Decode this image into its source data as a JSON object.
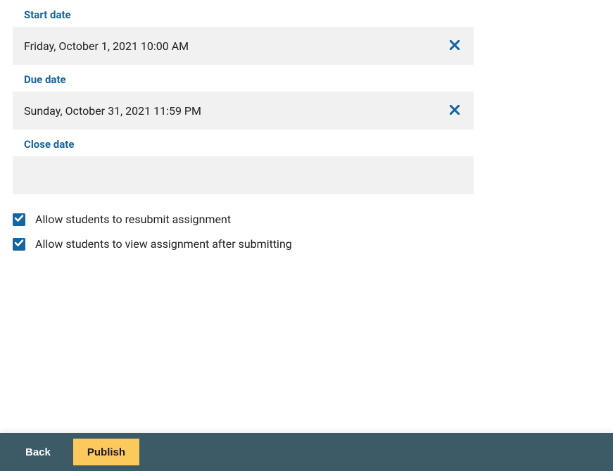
{
  "dates": {
    "start": {
      "label": "Start date",
      "value": "Friday, October 1, 2021 10:00 AM"
    },
    "due": {
      "label": "Due date",
      "value": "Sunday, October 31, 2021 11:59 PM"
    },
    "close": {
      "label": "Close date",
      "value": ""
    }
  },
  "checkboxes": {
    "resubmit": {
      "label": "Allow students to resubmit assignment",
      "checked": true
    },
    "viewAfterSubmit": {
      "label": "Allow students to view assignment after submitting",
      "checked": true
    }
  },
  "footer": {
    "back_label": "Back",
    "publish_label": "Publish"
  },
  "colors": {
    "accent": "#1565a2",
    "footerBg": "#3d5b66",
    "publishBg": "#fcc95c",
    "inputBg": "#f1f1f1"
  }
}
